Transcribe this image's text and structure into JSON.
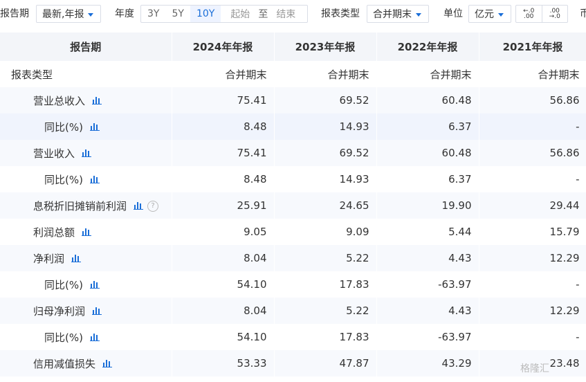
{
  "toolbar": {
    "period_label": "报告期",
    "period_value": "最新,年报",
    "year_label": "年度",
    "ranges": [
      "3Y",
      "5Y",
      "10Y"
    ],
    "active_range": "10Y",
    "start_label": "起始",
    "to_label": "至",
    "end_label": "结束",
    "type_label": "报表类型",
    "type_value": "合并期末",
    "unit_label": "单位",
    "unit_value": "亿元",
    "dec_less_top": "←.0",
    "dec_less_bottom": ".00",
    "dec_more_top": ".00",
    "dec_more_bottom": "→.0",
    "edge_char": "币"
  },
  "table": {
    "header": [
      "报告期",
      "2024年年报",
      "2023年年报",
      "2022年年报",
      "2021年年报"
    ],
    "rows": [
      {
        "name": "报表类型",
        "level": 0,
        "values": [
          "合并期末",
          "合并期末",
          "合并期末",
          "合并期末"
        ],
        "chart": false
      },
      {
        "name": "营业总收入",
        "level": 1,
        "values": [
          "75.41",
          "69.52",
          "60.48",
          "56.86"
        ],
        "chart": true
      },
      {
        "name": "同比(%)",
        "level": 2,
        "values": [
          "8.48",
          "14.93",
          "6.37",
          "-"
        ],
        "chart": true
      },
      {
        "name": "营业收入",
        "level": 1,
        "values": [
          "75.41",
          "69.52",
          "60.48",
          "56.86"
        ],
        "chart": true
      },
      {
        "name": "同比(%)",
        "level": 2,
        "values": [
          "8.48",
          "14.93",
          "6.37",
          "-"
        ],
        "chart": true
      },
      {
        "name": "息税折旧摊销前利润",
        "level": 1,
        "values": [
          "25.91",
          "24.65",
          "19.90",
          "29.44"
        ],
        "chart": true,
        "help": "?"
      },
      {
        "name": "利润总额",
        "level": 1,
        "values": [
          "9.05",
          "9.09",
          "5.44",
          "15.79"
        ],
        "chart": true
      },
      {
        "name": "净利润",
        "level": 1,
        "values": [
          "8.04",
          "5.22",
          "4.43",
          "12.29"
        ],
        "chart": true
      },
      {
        "name": "同比(%)",
        "level": 2,
        "values": [
          "54.10",
          "17.83",
          "-63.97",
          "-"
        ],
        "chart": true
      },
      {
        "name": "归母净利润",
        "level": 1,
        "values": [
          "8.04",
          "5.22",
          "4.43",
          "12.29"
        ],
        "chart": true
      },
      {
        "name": "同比(%)",
        "level": 2,
        "values": [
          "54.10",
          "17.83",
          "-63.97",
          "-"
        ],
        "chart": true
      },
      {
        "name": "信用减值损失",
        "level": 1,
        "values": [
          "53.33",
          "47.87",
          "43.29",
          "23.48"
        ],
        "chart": true
      }
    ]
  },
  "watermark": "格隆汇",
  "colors": {
    "accent": "#1a6ed8",
    "header_bg": "#f3f5f9",
    "row_alt": "#f7f9fd"
  }
}
